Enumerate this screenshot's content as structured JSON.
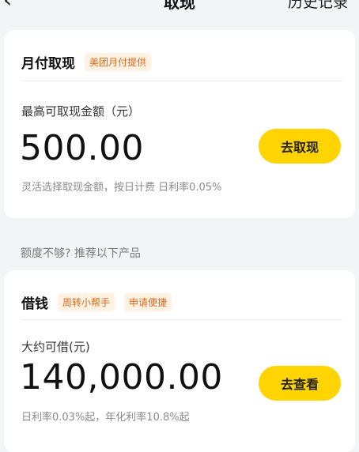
{
  "header": {
    "back_icon": "chevron-left-icon",
    "title": "取现",
    "history_label": "历史记录"
  },
  "card1": {
    "title": "月付取现",
    "tag": "美团月付提供",
    "amount_label": "最高可取现金额（元）",
    "amount": "500.00",
    "cta_label": "去取现",
    "note": "灵活选择取现金额，按日计费 日利率0.05%"
  },
  "recommend_text": "额度不够? 推荐以下产品",
  "card2": {
    "title": "借钱",
    "tags": [
      "周转小帮手",
      "申请便捷"
    ],
    "amount_label": "大约可借(元)",
    "amount": "140,000.00",
    "cta_label": "去查看",
    "note": "日利率0.03%起，年化利率10.8%起"
  },
  "colors": {
    "accent": "#ffd400",
    "tag_text": "#d96a1d",
    "tag_bg": "#fff2e3",
    "page_bg": "#f3f4f6"
  }
}
